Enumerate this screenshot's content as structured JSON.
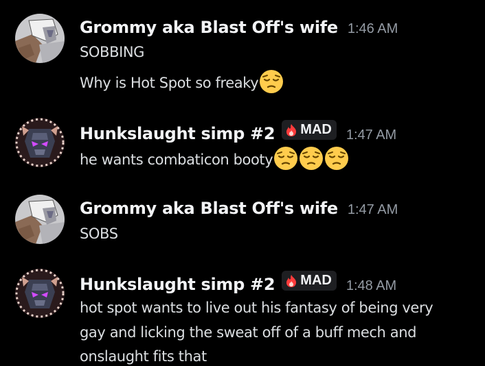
{
  "messages": [
    {
      "username": "Grommy aka Blast Off's wife",
      "timestamp": "1:46 AM",
      "lines": [
        "SOBBING",
        "Why is Hot Spot so freaky"
      ],
      "emoji_after_line2": "pensive-face-emoji"
    },
    {
      "username": "Hunkslaught simp #2",
      "tag": "MAD",
      "tag_icon": "flame-icon",
      "timestamp": "1:47 AM",
      "lines": [
        "he wants combaticon booty"
      ],
      "emojis": [
        "pensive-face-emoji",
        "pensive-face-emoji",
        "pensive-face-emoji"
      ]
    },
    {
      "username": "Grommy aka Blast Off's wife",
      "timestamp": "1:47 AM",
      "lines": [
        "SOBS"
      ]
    },
    {
      "username": "Hunkslaught simp #2",
      "tag": "MAD",
      "tag_icon": "flame-icon",
      "timestamp": "1:48 AM",
      "lines": [
        "hot spot wants to live out his fantasy of being very",
        "gay and licking the sweat off of a buff mech and",
        "onslaught fits that"
      ]
    }
  ],
  "colors": {
    "background": "#000000",
    "username": "#f2f3f5",
    "timestamp": "#949ba4",
    "message_text": "#dbdee1",
    "tag_bg": "#1e1f22",
    "emoji_yellow": "#ffcc4d"
  }
}
